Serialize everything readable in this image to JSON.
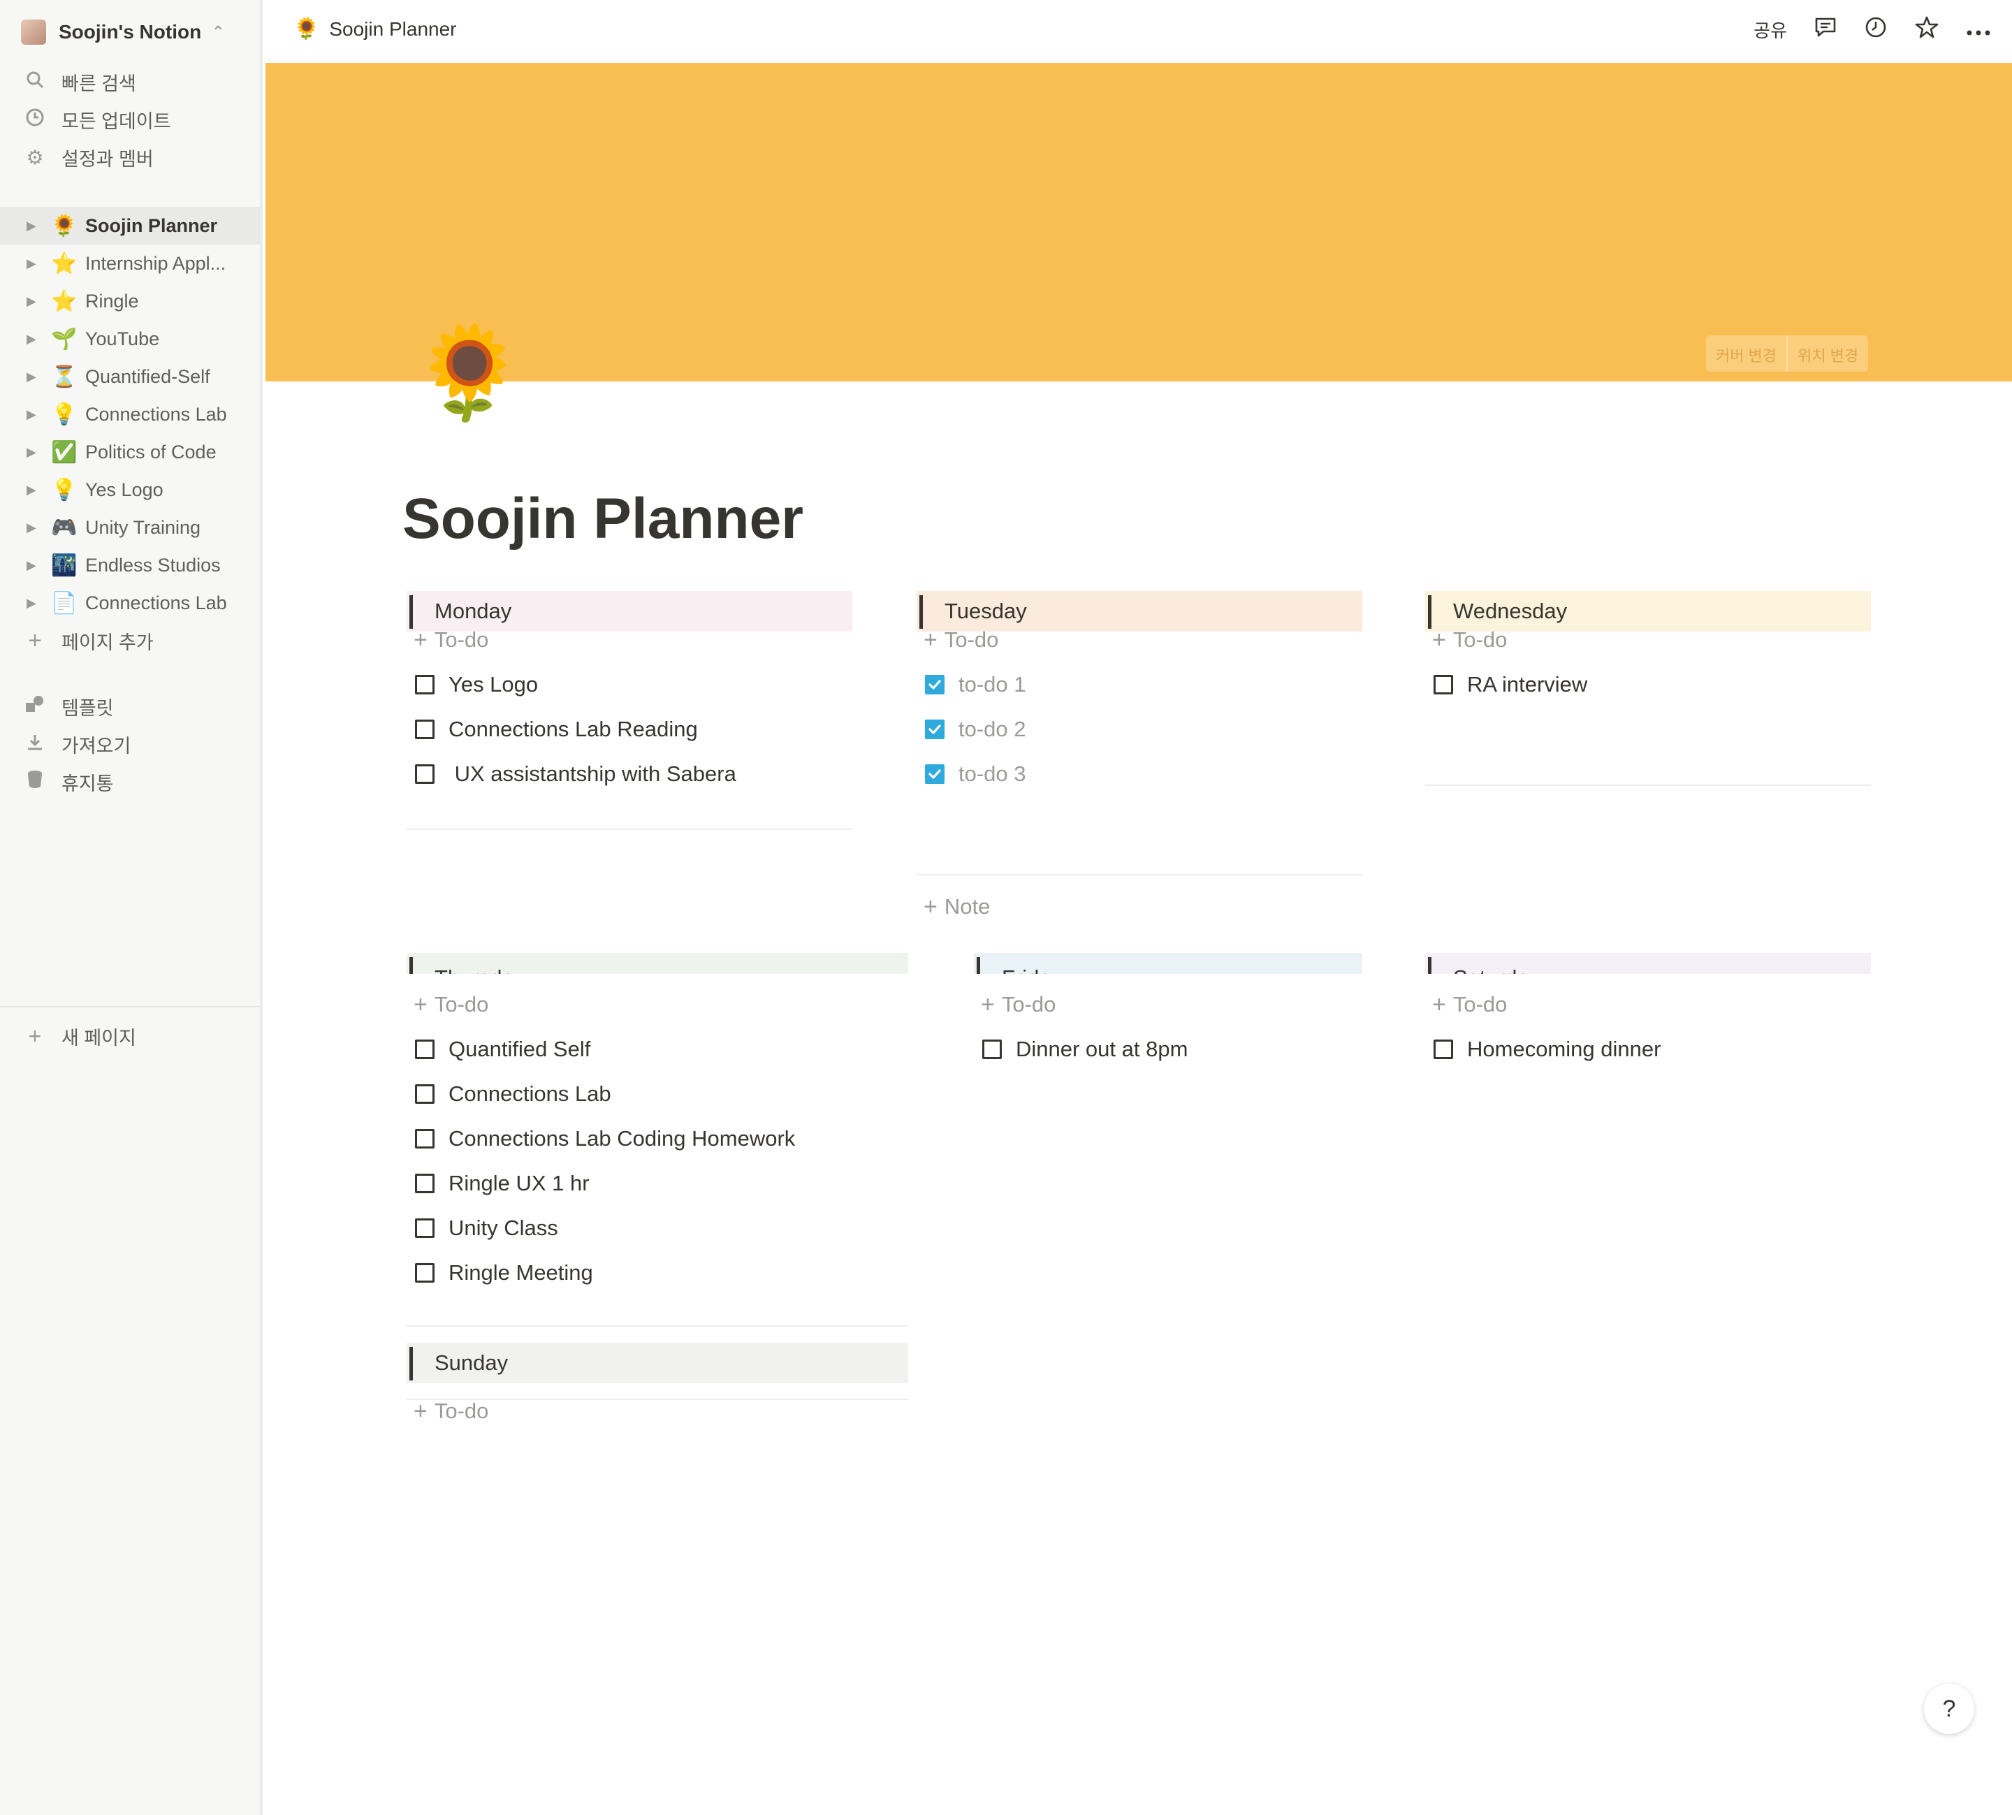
{
  "sidebar": {
    "workspace": "Soojin's Notion",
    "quick": [
      {
        "label": "빠른 검색",
        "icon": "search-icon"
      },
      {
        "label": "모든 업데이트",
        "icon": "clock-icon"
      },
      {
        "label": "설정과 멤버",
        "icon": "gear-icon"
      }
    ],
    "pages": [
      {
        "emoji": "🌻",
        "label": "Soojin Planner",
        "active": true
      },
      {
        "emoji": "⭐",
        "label": "Internship Appl..."
      },
      {
        "emoji": "⭐",
        "label": "Ringle"
      },
      {
        "emoji": "🌱",
        "label": "YouTube"
      },
      {
        "emoji": "⏳",
        "label": "Quantified-Self"
      },
      {
        "emoji": "💡",
        "label": "Connections Lab"
      },
      {
        "emoji": "✅",
        "label": "Politics of Code"
      },
      {
        "emoji": "💡",
        "label": "Yes Logo"
      },
      {
        "emoji": "🎮",
        "label": "Unity Training"
      },
      {
        "emoji": "🌃",
        "label": "Endless Studios"
      },
      {
        "emoji": "📄",
        "label": "Connections Lab"
      }
    ],
    "add_page": "페이지 추가",
    "tools": [
      {
        "label": "템플릿",
        "icon": "shapes-icon"
      },
      {
        "label": "가져오기",
        "icon": "download-icon"
      },
      {
        "label": "휴지통",
        "icon": "trash-icon"
      }
    ],
    "new_page": "새 페이지"
  },
  "topbar": {
    "breadcrumb_emoji": "🌻",
    "breadcrumb": "Soojin Planner",
    "share": "공유"
  },
  "cover": {
    "color": "#f8be52",
    "change_cover": "커버 변경",
    "reposition": "위치 변경"
  },
  "page": {
    "icon": "🌻",
    "title": "Soojin Planner"
  },
  "board": {
    "add_todo": "To-do",
    "add_note": "Note",
    "days": [
      {
        "name": "Monday",
        "color": "#f9eff3",
        "items": [
          {
            "text": "Yes Logo",
            "checked": false
          },
          {
            "text": "Connections Lab Reading",
            "checked": false
          },
          {
            "text": " UX assistantship with Sabera",
            "checked": false
          }
        ]
      },
      {
        "name": "Tuesday",
        "color": "#faebdd",
        "items": [
          {
            "text": "to-do 1",
            "checked": true
          },
          {
            "text": "to-do 2",
            "checked": true
          },
          {
            "text": "to-do 3",
            "checked": true
          }
        ]
      },
      {
        "name": "Wednesday",
        "color": "#fbf3db",
        "items": [
          {
            "text": "RA interview",
            "checked": false
          }
        ]
      },
      {
        "name": "Thursday",
        "color": "#eef3ed",
        "items": [
          {
            "text": "Quantified Self",
            "checked": false
          },
          {
            "text": "Connections Lab",
            "checked": false
          },
          {
            "text": "Connections Lab Coding Homework",
            "checked": false
          },
          {
            "text": "Ringle UX 1 hr",
            "checked": false
          },
          {
            "text": "Unity Class",
            "checked": false
          },
          {
            "text": "Ringle Meeting",
            "checked": false
          }
        ]
      },
      {
        "name": "Friday",
        "color": "#e9f3f7",
        "items": [
          {
            "text": "Dinner out at 8pm",
            "checked": false
          }
        ]
      },
      {
        "name": "Saturday",
        "color": "#f4f0f7",
        "items": [
          {
            "text": "Homecoming dinner",
            "checked": false
          }
        ]
      },
      {
        "name": "Sunday",
        "color": "#f1f1ef",
        "items": []
      }
    ]
  },
  "help": "?"
}
